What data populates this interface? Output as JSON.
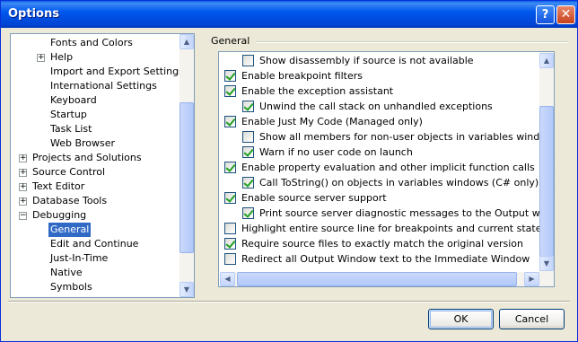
{
  "window": {
    "title": "Options",
    "help_icon": "?",
    "close_icon": "✕"
  },
  "tree": {
    "items": [
      {
        "label": "Fonts and Colors",
        "level": 2,
        "expander": ""
      },
      {
        "label": "Help",
        "level": 2,
        "expander": "+"
      },
      {
        "label": "Import and Export Settings",
        "level": 2,
        "expander": ""
      },
      {
        "label": "International Settings",
        "level": 2,
        "expander": ""
      },
      {
        "label": "Keyboard",
        "level": 2,
        "expander": ""
      },
      {
        "label": "Startup",
        "level": 2,
        "expander": ""
      },
      {
        "label": "Task List",
        "level": 2,
        "expander": ""
      },
      {
        "label": "Web Browser",
        "level": 2,
        "expander": ""
      },
      {
        "label": "Projects and Solutions",
        "level": 1,
        "expander": "+"
      },
      {
        "label": "Source Control",
        "level": 1,
        "expander": "+"
      },
      {
        "label": "Text Editor",
        "level": 1,
        "expander": "+"
      },
      {
        "label": "Database Tools",
        "level": 1,
        "expander": "+"
      },
      {
        "label": "Debugging",
        "level": 1,
        "expander": "−"
      },
      {
        "label": "General",
        "level": 2,
        "expander": "",
        "selected": true
      },
      {
        "label": "Edit and Continue",
        "level": 2,
        "expander": ""
      },
      {
        "label": "Just-In-Time",
        "level": 2,
        "expander": ""
      },
      {
        "label": "Native",
        "level": 2,
        "expander": ""
      },
      {
        "label": "Symbols",
        "level": 2,
        "expander": ""
      }
    ]
  },
  "section": {
    "title": "General"
  },
  "options": [
    {
      "label": "Show disassembly if source is not available",
      "checked": false,
      "indent": 1
    },
    {
      "label": "Enable breakpoint filters",
      "checked": true,
      "indent": 0
    },
    {
      "label": "Enable the exception assistant",
      "checked": true,
      "indent": 0
    },
    {
      "label": "Unwind the call stack on unhandled exceptions",
      "checked": true,
      "indent": 1
    },
    {
      "label": "Enable Just My Code (Managed only)",
      "checked": true,
      "indent": 0
    },
    {
      "label": "Show all members for non-user objects in variables windows (Visu",
      "checked": false,
      "indent": 1
    },
    {
      "label": "Warn if no user code on launch",
      "checked": true,
      "indent": 1
    },
    {
      "label": "Enable property evaluation and other implicit function calls",
      "checked": true,
      "indent": 0
    },
    {
      "label": "Call ToString() on objects in variables windows (C# only)",
      "checked": true,
      "indent": 1
    },
    {
      "label": "Enable source server support",
      "checked": true,
      "indent": 0
    },
    {
      "label": "Print source server diagnostic messages to the Output window",
      "checked": true,
      "indent": 1
    },
    {
      "label": "Highlight entire source line for breakpoints and current statement",
      "checked": false,
      "indent": 0
    },
    {
      "label": "Require source files to exactly match the original version",
      "checked": true,
      "indent": 0
    },
    {
      "label": "Redirect all Output Window text to the Immediate Window",
      "checked": false,
      "indent": 0
    }
  ],
  "buttons": {
    "ok": "OK",
    "cancel": "Cancel"
  },
  "colors": {
    "title_bar": "#0054e3",
    "selection": "#316ac5",
    "dialog_bg": "#ece9d8",
    "check": "#21a121"
  }
}
